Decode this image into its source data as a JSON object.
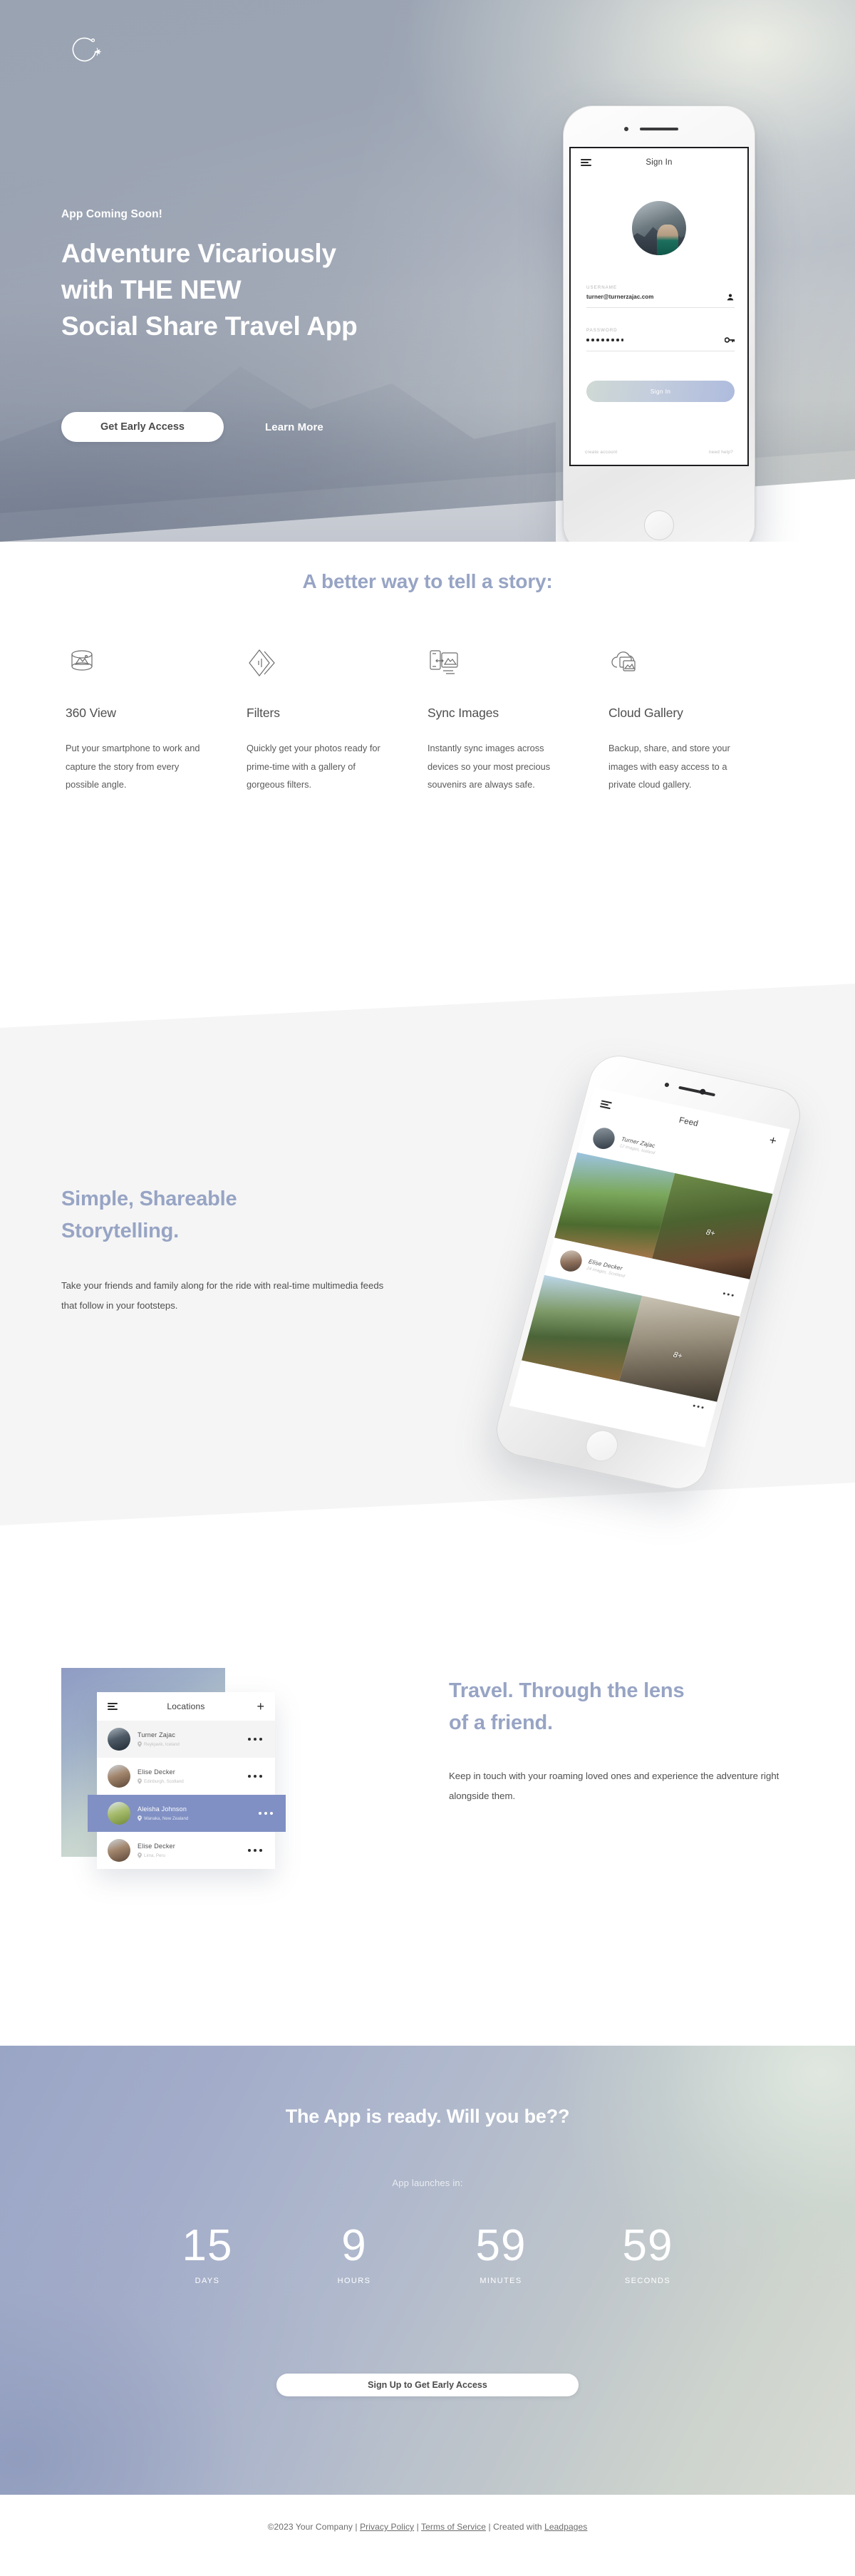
{
  "brand": {
    "logo_icon": "airplane-circle-logo",
    "accent_color": "#97a4c4",
    "text_color": "#4f4f4f"
  },
  "hero": {
    "eyebrow": "App Coming Soon!",
    "title_line1": "Adventure Vicariously",
    "title_line2": "with THE NEW",
    "title_line3": "Social Share Travel App",
    "primary_cta": "Get Early Access",
    "secondary_cta": "Learn More"
  },
  "hero_phone": {
    "menu_icon": "hamburger-icon",
    "screen_title": "Sign In",
    "username_label": "USERNAME",
    "username_value": "turner@turnerzajac.com",
    "username_icon": "person-icon",
    "password_label": "PASSWORD",
    "password_value": "••••••••",
    "password_icon": "key-icon",
    "submit_label": "Sign In",
    "link_left": "create account",
    "link_right": "need help?"
  },
  "features": {
    "heading": "A better way to tell a story:",
    "items": [
      {
        "icon": "panorama-360-icon",
        "title": "360 View",
        "body": "Put your smartphone to work and capture the story from every possible angle."
      },
      {
        "icon": "filters-diamond-icon",
        "title": "Filters",
        "body": "Quickly get your photos ready for prime-time with a gallery of gorgeous filters."
      },
      {
        "icon": "sync-images-icon",
        "title": "Sync Images",
        "body": "Instantly sync images across devices so your most precious souvenirs are always safe."
      },
      {
        "icon": "cloud-gallery-icon",
        "title": "Cloud Gallery",
        "body": "Backup, share, and store your images with easy access to a private cloud gallery."
      }
    ]
  },
  "storytelling": {
    "title_line1": "Simple, Shareable",
    "title_line2": "Storytelling.",
    "body": "Take your friends and family along for the ride with real-time multimedia feeds that follow in your footsteps."
  },
  "feed_phone": {
    "menu_icon": "hamburger-icon",
    "screen_title": "Feed",
    "add_icon": "plus-icon",
    "posts": [
      {
        "author": "Turner Zajac",
        "meta": "12 images, Iceland",
        "overflow_icon": "more-dots-icon",
        "more_count": "8+"
      },
      {
        "author": "Elise Decker",
        "meta": "24 images, Scotland",
        "overflow_icon": "more-dots-icon",
        "more_count": "8+"
      }
    ]
  },
  "lens": {
    "title_line1": "Travel. Through the lens",
    "title_line2": "of a friend.",
    "body": "Keep in touch with your roaming loved ones and experience the adventure right alongside them."
  },
  "locations": {
    "menu_icon": "hamburger-icon",
    "title": "Locations",
    "add_icon": "plus-icon",
    "rows": [
      {
        "name": "Turner Zajac",
        "place": "Reykjavik, Iceland",
        "pin_icon": "map-pin-icon",
        "overflow_icon": "more-dots-icon",
        "selected": false
      },
      {
        "name": "Elise Decker",
        "place": "Edinburgh, Scotland",
        "pin_icon": "map-pin-icon",
        "overflow_icon": "more-dots-icon",
        "selected": false
      },
      {
        "name": "Aleisha Johnson",
        "place": "Wanaka, New Zealand",
        "pin_icon": "map-pin-icon",
        "overflow_icon": "more-dots-icon",
        "selected": true
      },
      {
        "name": "Elise Decker",
        "place": "Lima, Peru",
        "pin_icon": "map-pin-icon",
        "overflow_icon": "more-dots-icon",
        "selected": false
      }
    ]
  },
  "countdown": {
    "title": "The App is ready. Will you be??",
    "subtitle": "App launches in:",
    "units": [
      {
        "value": "15",
        "label": "DAYS"
      },
      {
        "value": "9",
        "label": "HOURS"
      },
      {
        "value": "59",
        "label": "MINUTES"
      },
      {
        "value": "59",
        "label": "SECONDS"
      }
    ],
    "cta": "Sign Up to Get Early Access"
  },
  "footer": {
    "copyright": "©2023 Your Company | ",
    "privacy": "Privacy Policy",
    "sep1": " | ",
    "terms": "Terms of Service",
    "sep2": " | Created with ",
    "builder": "Leadpages"
  }
}
